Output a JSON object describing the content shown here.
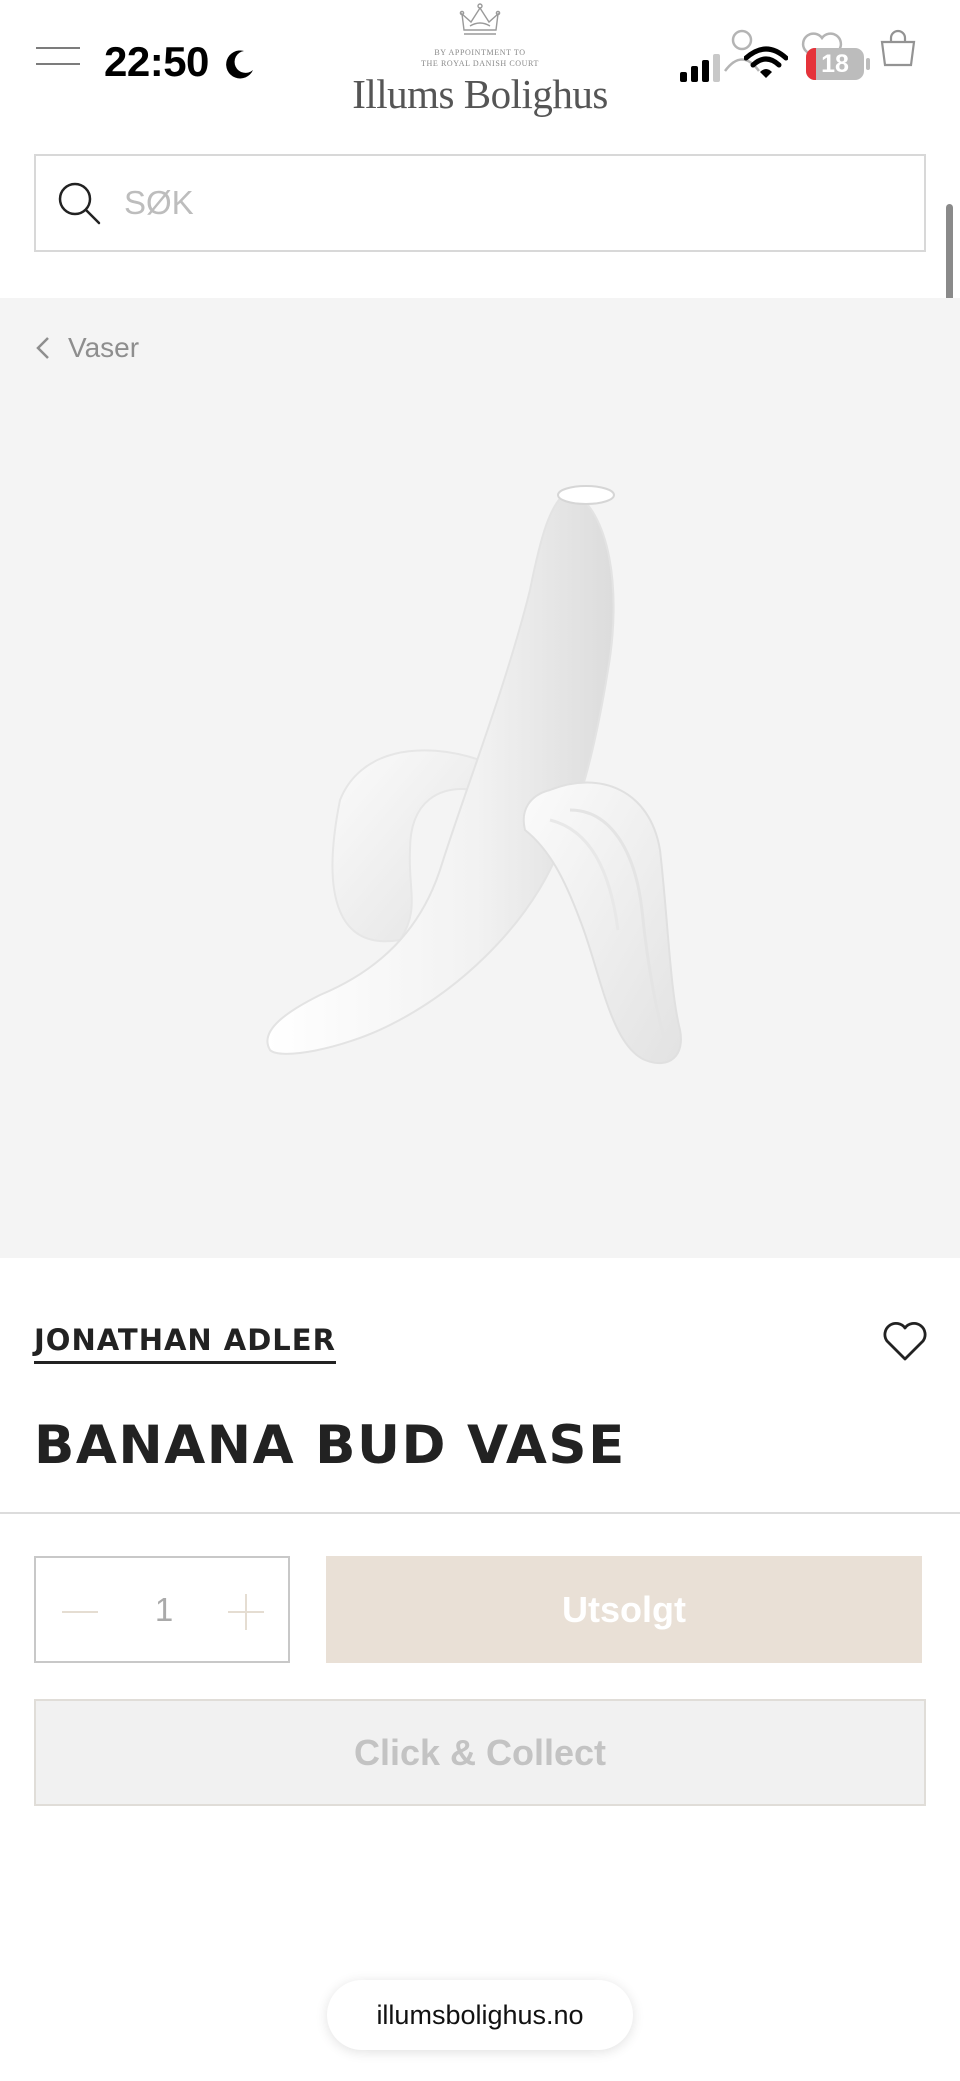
{
  "status_bar": {
    "time": "22:50",
    "battery_level": "18",
    "battery_fraction": 0.18
  },
  "header": {
    "logo": {
      "appointment_line1": "BY APPOINTMENT TO",
      "appointment_line2": "THE ROYAL DANISH COURT",
      "name": "Illums Bolighus"
    },
    "icons": [
      "menu-icon",
      "moon-icon",
      "crown-icon",
      "signal-icon",
      "wifi-icon",
      "account-icon",
      "wishlist-icon",
      "cart-icon"
    ]
  },
  "search": {
    "placeholder": "SØK",
    "value": ""
  },
  "breadcrumb": {
    "label": "Vaser"
  },
  "product": {
    "brand": "JONATHAN ADLER",
    "title": "BANANA BUD VASE",
    "quantity": "1",
    "soldout_label": "Utsolgt",
    "click_collect_label": "Click & Collect"
  },
  "browser": {
    "url": "illumsbolighus.no"
  },
  "colors": {
    "media_background": "#f4f4f4",
    "soldout_button": "#e9e0d6",
    "collect_button": "#f1f1f1",
    "text_dark": "#222222",
    "battery_low": "#e5333a"
  }
}
